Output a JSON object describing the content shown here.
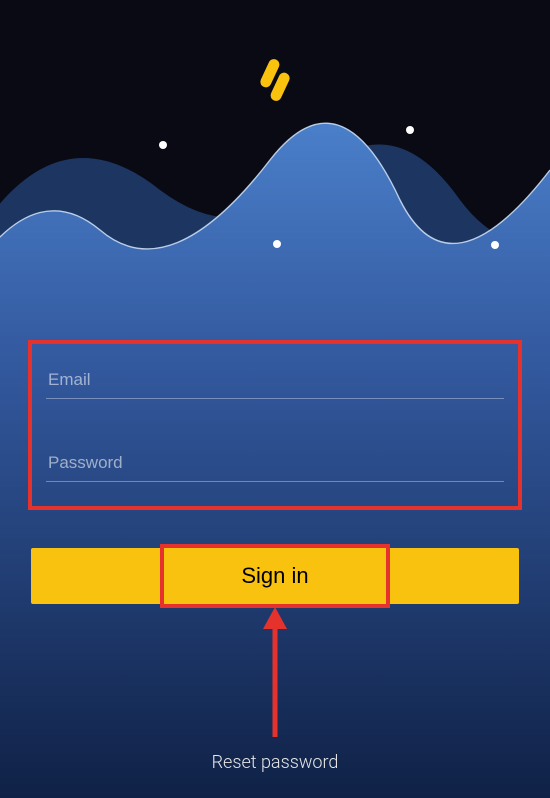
{
  "logo": {
    "name": "app-logo-icon"
  },
  "form": {
    "email_placeholder": "Email",
    "password_placeholder": "Password"
  },
  "signin_label": "Sign in",
  "reset_label": "Reset password",
  "colors": {
    "accent_yellow": "#f8c20f",
    "highlight_red": "#e5322d",
    "wave_blue": "#3d6fb8"
  }
}
